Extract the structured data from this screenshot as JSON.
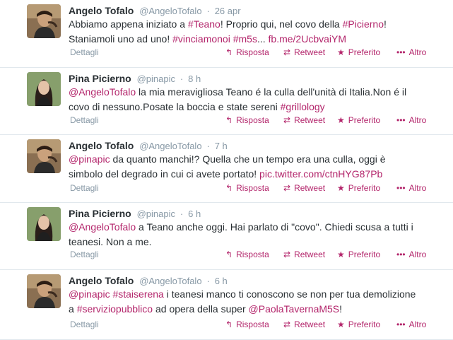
{
  "actions": {
    "details": "Dettagli",
    "reply": "Risposta",
    "retweet": "Retweet",
    "favorite": "Preferito",
    "more": "Altro"
  },
  "tweets": [
    {
      "name": "Angelo Tofalo",
      "handle": "@AngeloTofalo",
      "time": "26 apr",
      "segments": [
        {
          "t": "Abbiamo appena iniziato a ",
          "k": "pl"
        },
        {
          "t": "#Teano",
          "k": "ht"
        },
        {
          "t": "! Proprio qui, nel covo della ",
          "k": "pl"
        },
        {
          "t": "#Picierno",
          "k": "ht"
        },
        {
          "t": "! Staniamoli uno ad uno! ",
          "k": "pl"
        },
        {
          "t": "#vinciamonoi",
          "k": "ht"
        },
        {
          "t": " ",
          "k": "pl"
        },
        {
          "t": "#m5s",
          "k": "ht"
        },
        {
          "t": "... ",
          "k": "pl"
        },
        {
          "t": "fb.me/2UcbvaiYM",
          "k": "lk"
        }
      ]
    },
    {
      "name": "Pina Picierno",
      "handle": "@pinapic",
      "time": "8 h",
      "segments": [
        {
          "t": "@AngeloTofalo",
          "k": "lk"
        },
        {
          "t": " la mia meravigliosa Teano é la culla dell'unità di Italia.Non é il covo di nessuno.Posate la boccia e state sereni ",
          "k": "pl"
        },
        {
          "t": "#grillology",
          "k": "ht"
        }
      ]
    },
    {
      "name": "Angelo Tofalo",
      "handle": "@AngeloTofalo",
      "time": "7 h",
      "segments": [
        {
          "t": "@pinapic",
          "k": "lk"
        },
        {
          "t": " da quanto manchi!? Quella che un tempo era una culla, oggi è simbolo del degrado in cui ci avete portato! ",
          "k": "pl"
        },
        {
          "t": "pic.twitter.com/ctnHYG87Pb",
          "k": "lk"
        }
      ]
    },
    {
      "name": "Pina Picierno",
      "handle": "@pinapic",
      "time": "6 h",
      "segments": [
        {
          "t": "@AngeloTofalo",
          "k": "lk"
        },
        {
          "t": " a Teano anche oggi. Hai parlato di \"covo\". Chiedi scusa a tutti i teanesi. Non a me.",
          "k": "pl"
        }
      ]
    },
    {
      "name": "Angelo Tofalo",
      "handle": "@AngeloTofalo",
      "time": "6 h",
      "segments": [
        {
          "t": "@pinapic",
          "k": "lk"
        },
        {
          "t": " ",
          "k": "pl"
        },
        {
          "t": "#staiserena",
          "k": "ht"
        },
        {
          "t": " i teanesi manco ti conoscono se non per tua demolizione a ",
          "k": "pl"
        },
        {
          "t": "#serviziopubblico",
          "k": "ht"
        },
        {
          "t": " ad opera della super ",
          "k": "pl"
        },
        {
          "t": "@PaolaTavernaM5S",
          "k": "lk"
        },
        {
          "t": "!",
          "k": "pl"
        }
      ]
    }
  ]
}
